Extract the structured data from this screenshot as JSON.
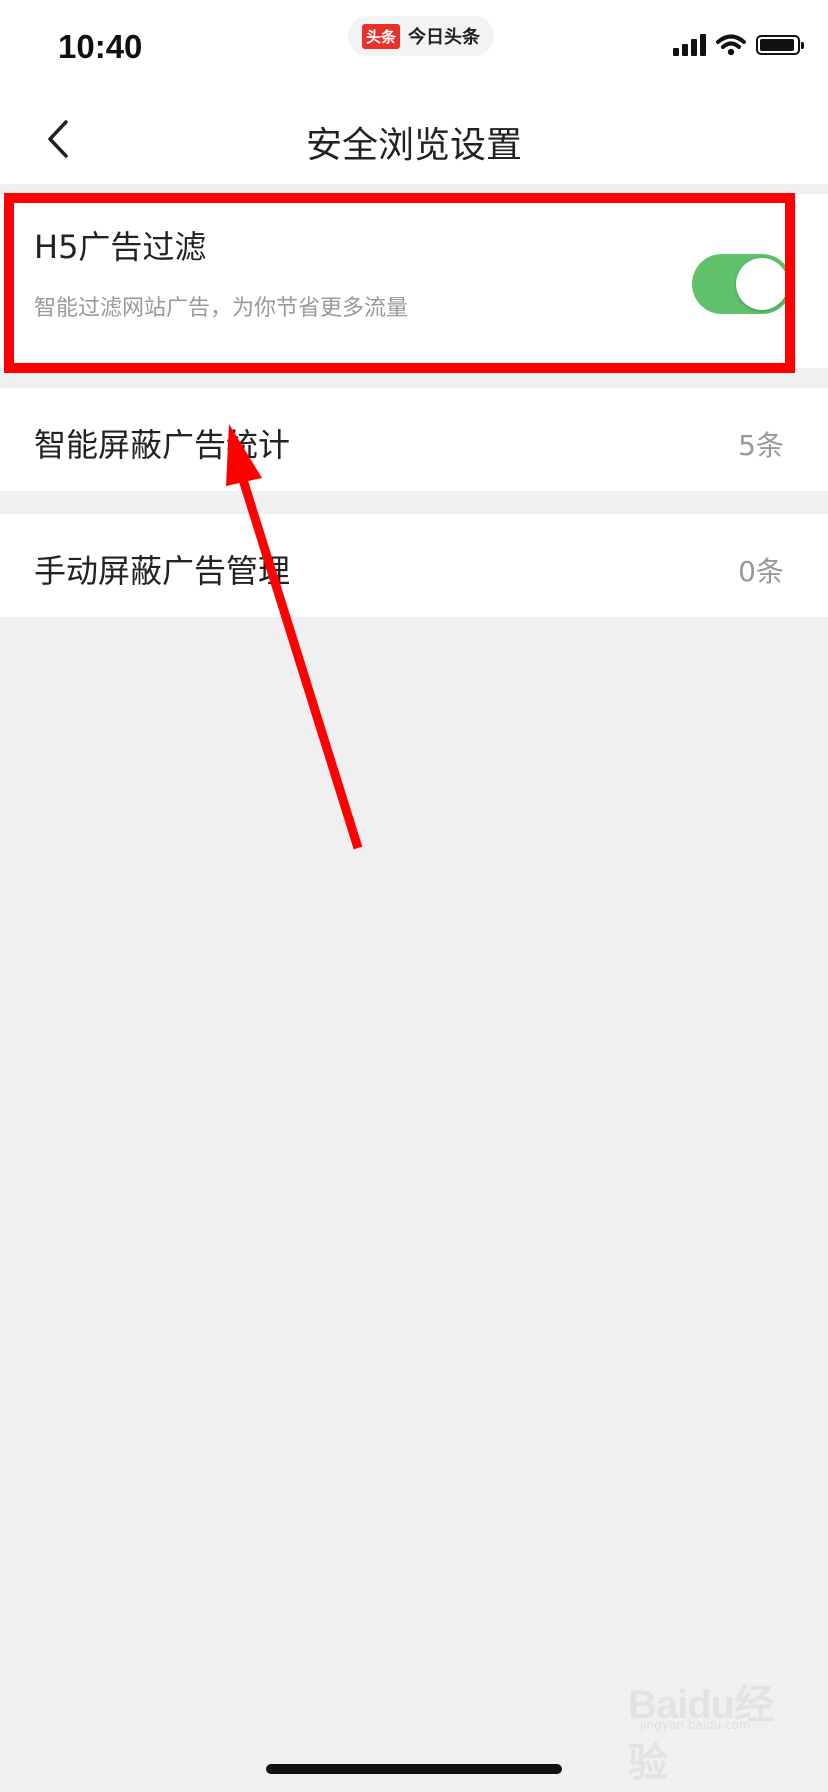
{
  "status_bar": {
    "time": "10:40",
    "app_badge": "头条",
    "app_name": "今日头条",
    "icons": [
      "cellular-signal-icon",
      "wifi-icon",
      "battery-icon"
    ]
  },
  "nav": {
    "back_icon": "chevron-left-icon",
    "title": "安全浏览设置"
  },
  "settings": {
    "h5_filter": {
      "title": "H5广告过滤",
      "subtitle": "智能过滤网站广告，为你节省更多流量",
      "enabled": true
    },
    "smart_block_stats": {
      "title": "智能屏蔽广告统计",
      "value": "5条"
    },
    "manual_block_manage": {
      "title": "手动屏蔽广告管理",
      "value": "0条"
    }
  },
  "watermark": {
    "text": "Baidu经验",
    "sub": "jingyan.baidu.com"
  },
  "colors": {
    "toggle_on": "#5fc16a",
    "annotation_red": "#ff0000",
    "page_bg": "#f0f0f0"
  }
}
